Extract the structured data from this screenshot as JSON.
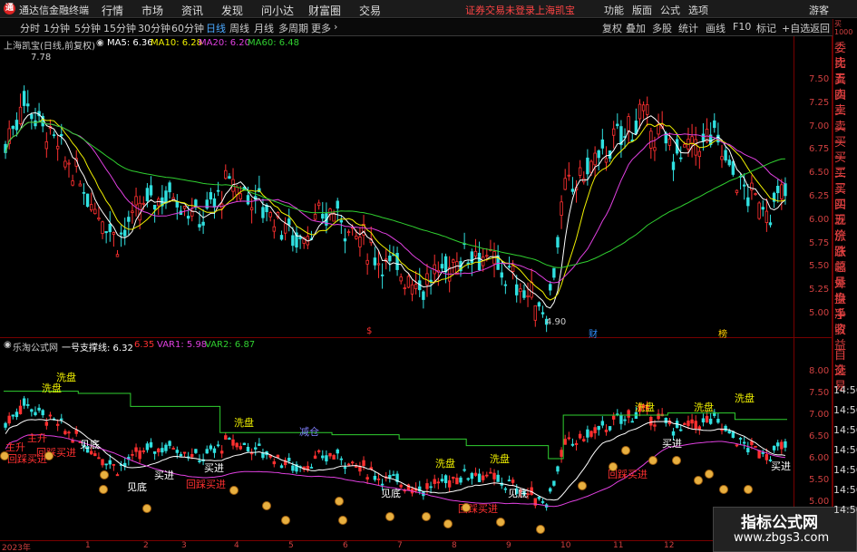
{
  "app": {
    "title": "通达信金融终端",
    "menu": [
      "行情",
      "市场",
      "资讯",
      "发现",
      "问小达",
      "财富圈",
      "交易"
    ],
    "status": "证券交易未登录",
    "stock": "上海凯宝",
    "right_menu": [
      "功能",
      "版面",
      "公式",
      "选项"
    ],
    "guest": "游客"
  },
  "tabs": [
    "分时",
    "1分钟",
    "5分钟",
    "15分钟",
    "30分钟",
    "60分钟",
    "日线",
    "周线",
    "月线",
    "多周期",
    "更多"
  ],
  "active_tab": "日线",
  "toolbar_right": [
    "复权",
    "叠加",
    "多股",
    "统计",
    "画线",
    "F10",
    "标记",
    "+自选",
    "返回"
  ],
  "price_panel": {
    "title": "上海凯宝(日线,前复权)",
    "legend": [
      {
        "label": "MA5: 6.36",
        "color": "#ffffff"
      },
      {
        "label": "MA10: 6.28",
        "color": "#f0f000"
      },
      {
        "label": "MA20: 6.20",
        "color": "#e040e0"
      },
      {
        "label": "MA60: 6.48",
        "color": "#30d030"
      }
    ],
    "high": "7.78",
    "low": "4.90",
    "ticks": [
      "7.50",
      "7.25",
      "7.00",
      "6.75",
      "6.50",
      "6.25",
      "6.00",
      "5.75",
      "5.50",
      "5.25",
      "5.00"
    ],
    "markers": [
      {
        "text": "$",
        "color": "#ff3030"
      },
      {
        "text": "财",
        "color": "#3090ff"
      },
      {
        "text": "榜",
        "color": "#ffd000"
      }
    ]
  },
  "indicator_panel": {
    "title": "乐淘公式网",
    "legend": [
      {
        "label": "一号支撑线: 6.32",
        "color": "#ffffff"
      },
      {
        "label": "6.35",
        "color": "#ff3030"
      },
      {
        "label": "VAR1: 5.98",
        "color": "#e040e0"
      },
      {
        "label": "VAR2: 6.87",
        "color": "#30d030"
      }
    ],
    "ticks": [
      "8.00",
      "7.50",
      "7.00",
      "6.50",
      "6.00",
      "5.50",
      "5.00"
    ],
    "labels": [
      "洗盘",
      "主升",
      "回踩买进",
      "见底",
      "买进",
      "加仓",
      "减仓"
    ]
  },
  "right_panel": {
    "top": [
      "委比",
      "卖五",
      "卖四",
      "卖三",
      "卖二",
      "卖一",
      "买一",
      "买二",
      "买三",
      "买四",
      "买五",
      "现价",
      "涨跌",
      "涨幅",
      "总量",
      "外盘",
      "换手",
      "净资",
      "收益"
    ],
    "mid": [
      "自选",
      "交易"
    ],
    "times": [
      "14:56",
      "14:56",
      "14:56",
      "14:56",
      "14:56",
      "14:56",
      "14:56"
    ],
    "num": "1000"
  },
  "dates": [
    "2023年",
    "1",
    "2",
    "3",
    "4",
    "5",
    "6",
    "7",
    "8",
    "9",
    "10",
    "11",
    "12"
  ],
  "watermark": {
    "line1": "指标公式网",
    "line2": "www.zbgs3.com"
  }
}
